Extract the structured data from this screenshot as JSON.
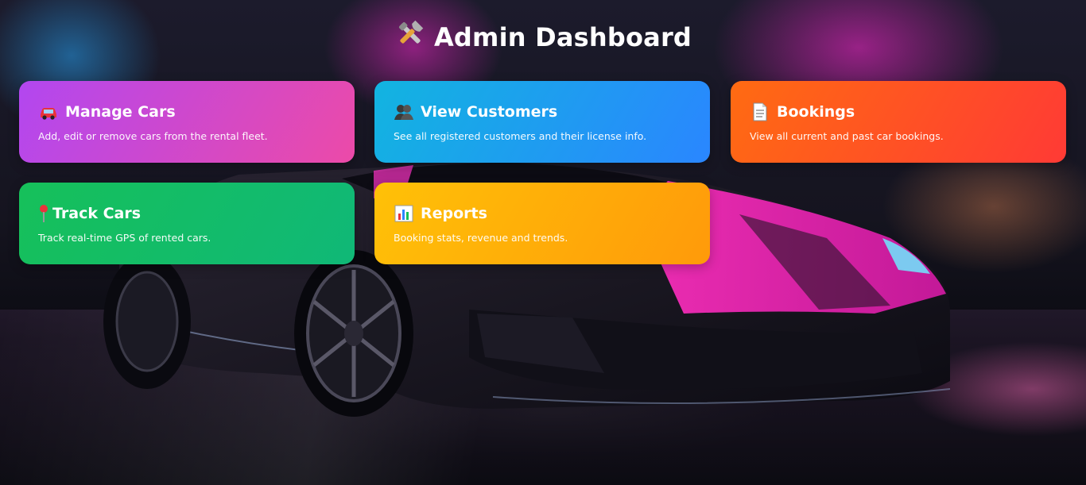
{
  "header": {
    "title": "Admin Dashboard",
    "icon": "tools-icon"
  },
  "cards": [
    {
      "title": "Manage Cars",
      "description": "Add, edit or remove cars from the rental fleet.",
      "icon": "car-icon",
      "gradient": [
        "#b247f0",
        "#ec4aa8"
      ]
    },
    {
      "title": "View Customers",
      "description": "See all registered customers and their license info.",
      "icon": "users-icon",
      "gradient": [
        "#12b4e0",
        "#2a86ff"
      ]
    },
    {
      "title": "Bookings",
      "description": "View all current and past car bookings.",
      "icon": "document-icon",
      "gradient": [
        "#ff6b12",
        "#ff3a35"
      ]
    },
    {
      "title": "Track Cars",
      "description": "Track real-time GPS of rented cars.",
      "icon": "pin-icon",
      "gradient": [
        "#16c05a",
        "#10b877"
      ]
    },
    {
      "title": "Reports",
      "description": "Booking stats, revenue and trends.",
      "icon": "bar-chart-icon",
      "gradient": [
        "#ffc107",
        "#ff9a0a"
      ]
    }
  ],
  "background": "sports-car-neon-city-image"
}
